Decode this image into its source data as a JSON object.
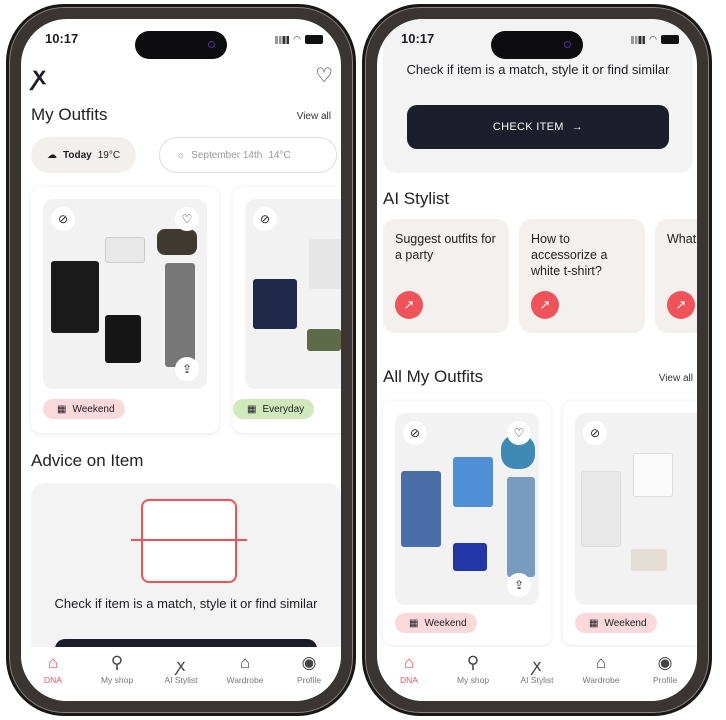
{
  "status": {
    "time": "10:17"
  },
  "colors": {
    "accent": "#f0525a",
    "dark_button": "#1c1e2c",
    "tag_pink": "#fbd9da",
    "tag_green": "#cfe9bb"
  },
  "left": {
    "header": {
      "logo": "hanger-logo-icon",
      "favorites_icon": "heart-icon"
    },
    "my_outfits": {
      "title": "My Outfits",
      "view_all": "View all",
      "weather": [
        {
          "label": "Today",
          "temp": "19°C",
          "icon": "rain-cloud-icon"
        },
        {
          "label": "September 14th",
          "temp": "14°C",
          "icon": "sun-cloud-icon"
        }
      ],
      "cards": [
        {
          "tag": "Weekend"
        },
        {
          "tag": "Everyday"
        }
      ]
    },
    "advice": {
      "title": "Advice on Item",
      "text": "Check if item is a match, style it or find similar"
    }
  },
  "right": {
    "advice": {
      "text": "Check if item is a match, style it or find similar",
      "button": "CHECK ITEM",
      "button_icon": "arrow-right-icon"
    },
    "ai_stylist": {
      "title": "AI Stylist",
      "suggestions": [
        "Suggest outfits for a party",
        "How to accessorize a white t-shirt?",
        "What... my l..."
      ]
    },
    "all_outfits": {
      "title": "All My Outfits",
      "view_all": "View all",
      "cards": [
        {
          "tag": "Weekend"
        },
        {
          "tag": "Weekend"
        }
      ]
    }
  },
  "nav": [
    {
      "label": "DNA",
      "icon": "home-icon",
      "active": true
    },
    {
      "label": "My shop",
      "icon": "search-icon"
    },
    {
      "label": "AI Stylist",
      "icon": "ai-stylist-icon"
    },
    {
      "label": "Wardrobe",
      "icon": "hanger-icon"
    },
    {
      "label": "Profile",
      "icon": "profile-icon"
    }
  ]
}
